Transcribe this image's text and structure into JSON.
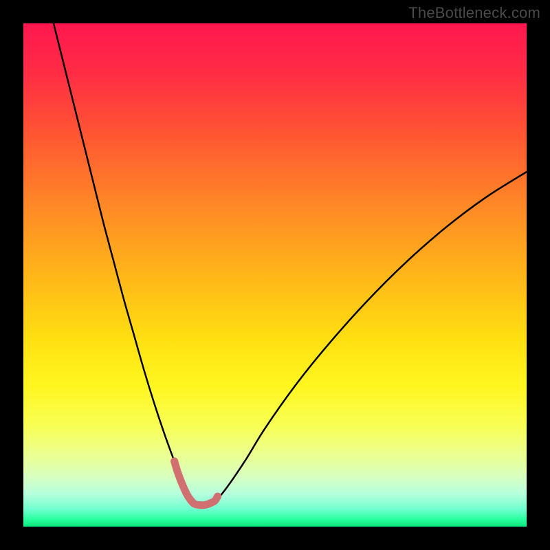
{
  "watermark": "TheBottleneck.com",
  "gradient": {
    "stops": [
      {
        "pos": 0.0,
        "color": "#ff174f"
      },
      {
        "pos": 0.1,
        "color": "#ff2d44"
      },
      {
        "pos": 0.22,
        "color": "#ff5533"
      },
      {
        "pos": 0.35,
        "color": "#ff8427"
      },
      {
        "pos": 0.5,
        "color": "#ffb619"
      },
      {
        "pos": 0.63,
        "color": "#ffe011"
      },
      {
        "pos": 0.72,
        "color": "#fff61f"
      },
      {
        "pos": 0.8,
        "color": "#f8ff55"
      },
      {
        "pos": 0.86,
        "color": "#eaff94"
      },
      {
        "pos": 0.9,
        "color": "#d8ffbf"
      },
      {
        "pos": 0.935,
        "color": "#b6ffdd"
      },
      {
        "pos": 0.965,
        "color": "#71ffd0"
      },
      {
        "pos": 0.985,
        "color": "#2bff9e"
      },
      {
        "pos": 1.0,
        "color": "#08e87e"
      }
    ]
  },
  "curve_style": {
    "stroke": "#000000",
    "stroke_width": 2.5
  },
  "marker_style": {
    "stroke": "#d17070",
    "stroke_width": 11,
    "fill": "none"
  },
  "chart_data": {
    "type": "line",
    "title": "",
    "xlabel": "",
    "ylabel": "",
    "xlim": [
      0,
      100
    ],
    "ylim": [
      0,
      100
    ],
    "note": "Bottleneck curve: y-axis is bottleneck percentage (100 = worst at top, 0 = best at bottom of plot area). x is a normalized hardware balance parameter. Values estimated from gridless chart.",
    "series": [
      {
        "name": "bottleneck-curve",
        "x": [
          6,
          8,
          10,
          12,
          14,
          16,
          18,
          20,
          22,
          24,
          26,
          28,
          30,
          31,
          32,
          33,
          34,
          35,
          36,
          38,
          40,
          44,
          48,
          54,
          60,
          68,
          76,
          84,
          92,
          100
        ],
        "y": [
          100,
          92,
          84,
          76,
          68,
          60,
          52.5,
          45,
          38,
          31,
          24.5,
          18.5,
          13,
          10.5,
          8.3,
          6.5,
          5.2,
          4.5,
          4.3,
          5.1,
          7.2,
          13,
          19.5,
          28,
          35.5,
          44.5,
          52.5,
          59.5,
          65.5,
          70.5
        ]
      },
      {
        "name": "optimal-marker-segment",
        "x": [
          30,
          30.6,
          31.5,
          32.5,
          33.3,
          34,
          35,
          36,
          37,
          38,
          38.6
        ],
        "y": [
          13,
          11,
          8.6,
          6.4,
          5.2,
          4.5,
          4.3,
          4.3,
          4.6,
          5.1,
          6
        ]
      }
    ]
  }
}
